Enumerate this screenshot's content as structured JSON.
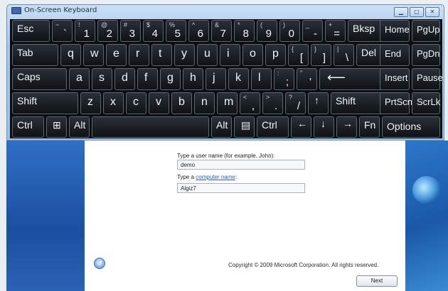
{
  "osk": {
    "title": "On-Screen Keyboard",
    "window_buttons": {
      "minimize": "▁",
      "maximize": "□",
      "close": "✕"
    }
  },
  "keys": {
    "esc": "Esc",
    "backtick": {
      "alt": "~",
      "main": "`"
    },
    "n1": {
      "alt": "!",
      "main": "1"
    },
    "n2": {
      "alt": "@",
      "main": "2"
    },
    "n3": {
      "alt": "#",
      "main": "3"
    },
    "n4": {
      "alt": "$",
      "main": "4"
    },
    "n5": {
      "alt": "%",
      "main": "5"
    },
    "n6": {
      "alt": "^",
      "main": "6"
    },
    "n7": {
      "alt": "&",
      "main": "7"
    },
    "n8": {
      "alt": "*",
      "main": "8"
    },
    "n9": {
      "alt": "(",
      "main": "9"
    },
    "n0": {
      "alt": ")",
      "main": "0"
    },
    "minus": {
      "alt": "_",
      "main": "-"
    },
    "equals": {
      "alt": "+",
      "main": "="
    },
    "bksp": "Bksp",
    "home": "Home",
    "pgup": "PgUp",
    "tab": "Tab",
    "q": "q",
    "w": "w",
    "e": "e",
    "r": "r",
    "t": "t",
    "y": "y",
    "u": "u",
    "i": "i",
    "o": "o",
    "p": "p",
    "lbracket": {
      "alt": "{",
      "main": "["
    },
    "rbracket": {
      "alt": "}",
      "main": "]"
    },
    "backslash": {
      "alt": "|",
      "main": "\\"
    },
    "del": "Del",
    "end": "End",
    "pgdn": "PgDn",
    "caps": "Caps",
    "a": "a",
    "s": "s",
    "d": "d",
    "f": "f",
    "g": "g",
    "h": "h",
    "j": "j",
    "k": "k",
    "l": "l",
    "semicolon": {
      "alt": ":",
      "main": ";"
    },
    "quote": {
      "alt": "\"",
      "main": "'"
    },
    "enter": "⟵",
    "insert": "Insert",
    "pause": "Pause",
    "shift_left": "Shift",
    "z": "z",
    "x": "x",
    "c": "c",
    "v": "v",
    "b": "b",
    "n": "n",
    "m": "m",
    "comma": {
      "alt": "<",
      "main": ","
    },
    "period": {
      "alt": ">",
      "main": "."
    },
    "slash": {
      "alt": "?",
      "main": "/"
    },
    "up": "↑",
    "shift_right": "Shift",
    "prtscn": "PrtScn",
    "scrlk": "ScrLk",
    "ctrl_left": "Ctrl",
    "win": "⊞",
    "alt_left": "Alt",
    "alt_right": "Alt",
    "menu": "▤",
    "ctrl_right": "Ctrl",
    "left": "←",
    "down": "↓",
    "right": "→",
    "fn": "Fn",
    "options": "Options"
  },
  "setup": {
    "username_label": "Type a user name (for example, John):",
    "username_value": "demo",
    "computer_label_prefix": "Type a ",
    "computer_label_link": "computer name",
    "computer_label_suffix": ":",
    "computer_value": "Algiz7",
    "copyright": "Copyright © 2009 Microsoft Corporation.  All rights reserved.",
    "next": "Next",
    "accessibility_icon": "↺"
  },
  "colors": {
    "key_bg": "#1a1e24",
    "key_border": "#5e6772",
    "title_bar": "#b3d0ef",
    "link": "#2a5db0"
  }
}
